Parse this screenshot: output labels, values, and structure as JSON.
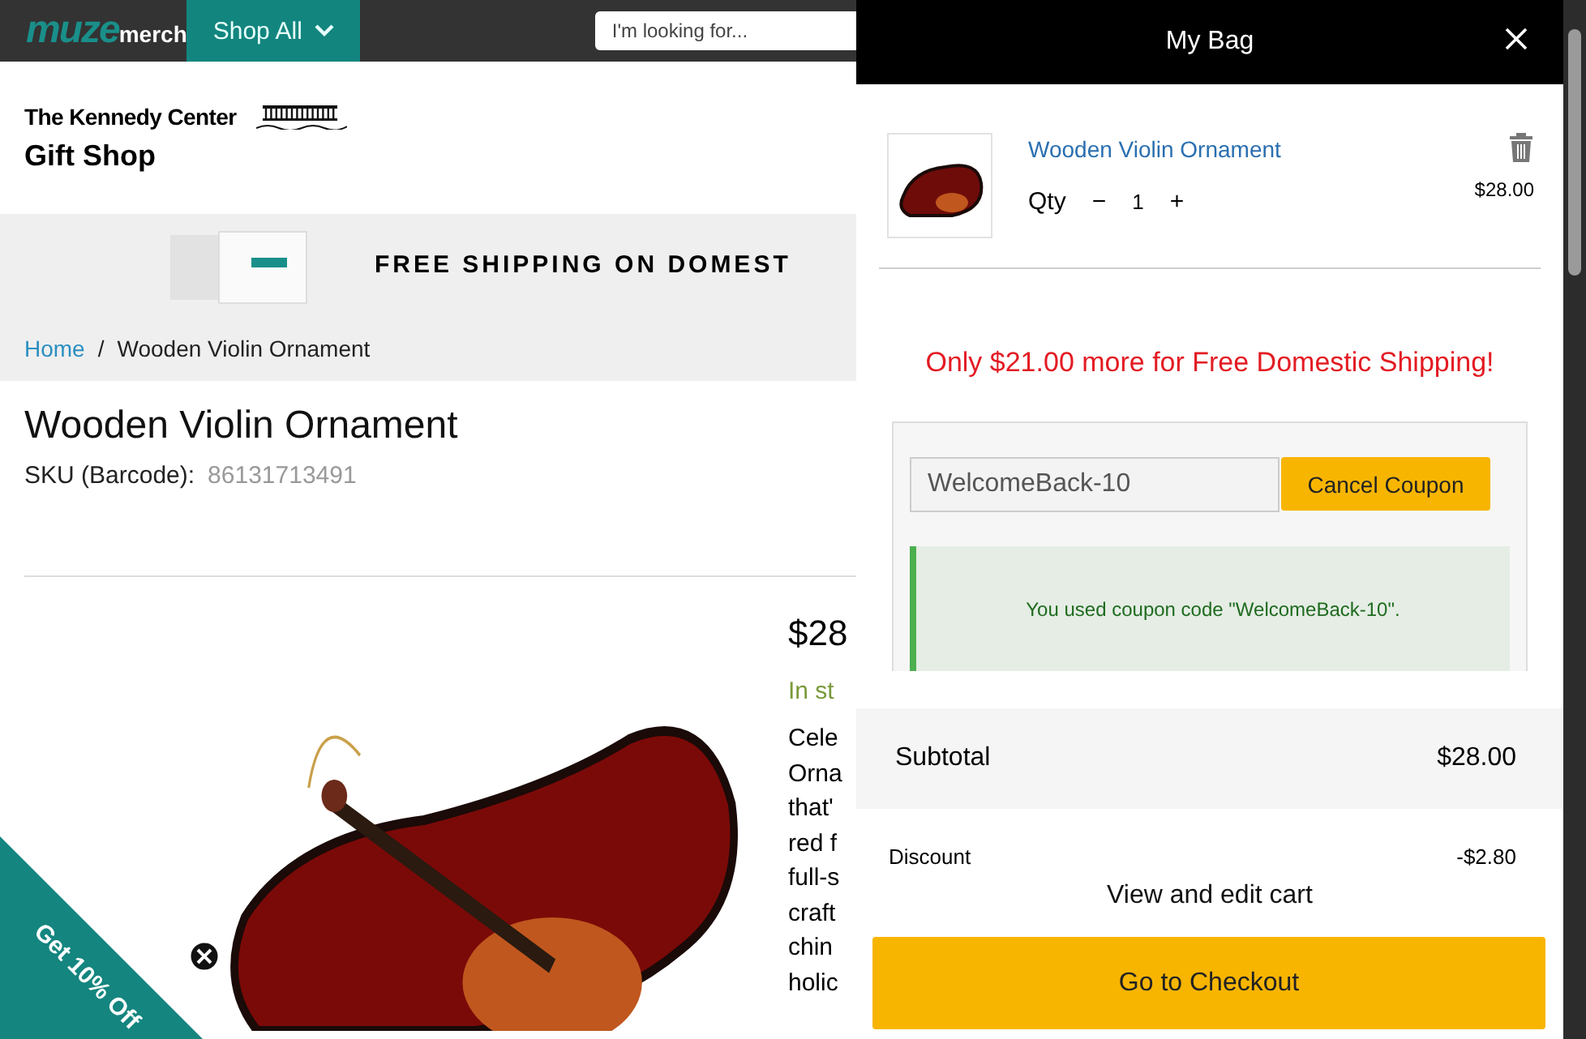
{
  "header": {
    "logo": {
      "main": "muze",
      "sub": "merch"
    },
    "menu_button": "Shop All",
    "search": {
      "placeholder": "I'm looking for..."
    }
  },
  "brand": {
    "line_1": "The Kennedy Center",
    "line_2": "Gift Shop"
  },
  "banner": {
    "text": "FREE SHIPPING ON DOMEST"
  },
  "breadcrumb": {
    "separator": "/",
    "items": [
      {
        "label": "Home",
        "kind": "link"
      },
      {
        "label": "Wooden Violin Ornament",
        "kind": "current"
      }
    ]
  },
  "product": {
    "title": "Wooden Violin Ornament",
    "sku_label": "SKU (Barcode):",
    "sku": "86131713491",
    "price": "$28",
    "stock": "In st",
    "description_lines": [
      "Cele",
      "Orna",
      "that'",
      "red f",
      "full-s",
      "craft",
      "chin",
      "holic"
    ]
  },
  "promo": {
    "label": "Get 10% Off"
  },
  "bag": {
    "title": "My Bag",
    "items": [
      {
        "name": "Wooden Violin Ornament",
        "qty_label": "Qty",
        "minus": "−",
        "qty": "1",
        "plus": "+",
        "price": "$28.00"
      }
    ],
    "shipping_notice": "Only $21.00 more for Free Domestic Shipping!",
    "coupon": {
      "value": "WelcomeBack-10",
      "button": "Cancel Coupon",
      "message": "You used coupon code \"WelcomeBack-10\"."
    },
    "totals": [
      {
        "label": "Subtotal",
        "value": "$28.00",
        "kind": "subtotal"
      },
      {
        "label": "Discount",
        "value": "-$2.80",
        "kind": "discount"
      }
    ],
    "view_cart": "View and edit cart",
    "checkout": "Go to Checkout"
  }
}
